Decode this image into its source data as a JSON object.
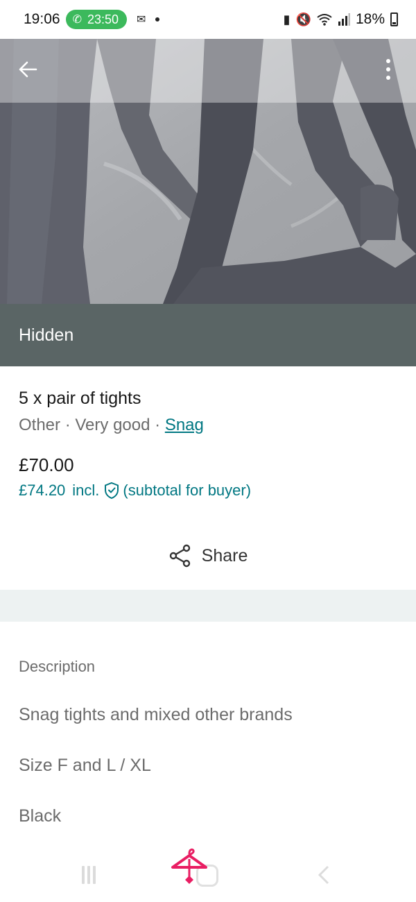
{
  "status_bar": {
    "time": "19:06",
    "call_timer": "23:50",
    "battery": "18%",
    "icons": [
      "phone-icon",
      "message-icon",
      "battery-saver-icon",
      "mute-icon",
      "wifi-icon",
      "signal-icon",
      "battery-icon"
    ]
  },
  "header": {
    "back_icon": "arrow-left-icon",
    "more_icon": "more-vertical-icon"
  },
  "banner": {
    "label": "Hidden"
  },
  "item": {
    "title": "5 x pair of tights",
    "category": "Other",
    "separator": "·",
    "condition": "Very good",
    "brand": "Snag",
    "price": "£70.00",
    "buyer_price": "£74.20",
    "buyer_incl": "incl.",
    "buyer_note": "(subtotal for buyer)"
  },
  "share": {
    "label": "Share",
    "icon": "share-icon"
  },
  "description": {
    "label": "Description",
    "lines": [
      "Snag tights and mixed other brands",
      "Size F and L / XL",
      "Black"
    ]
  },
  "colors": {
    "accent": "#007782",
    "banner": "#5a6565",
    "call_pill": "#3cb95c",
    "hanger": "#e91e63"
  }
}
